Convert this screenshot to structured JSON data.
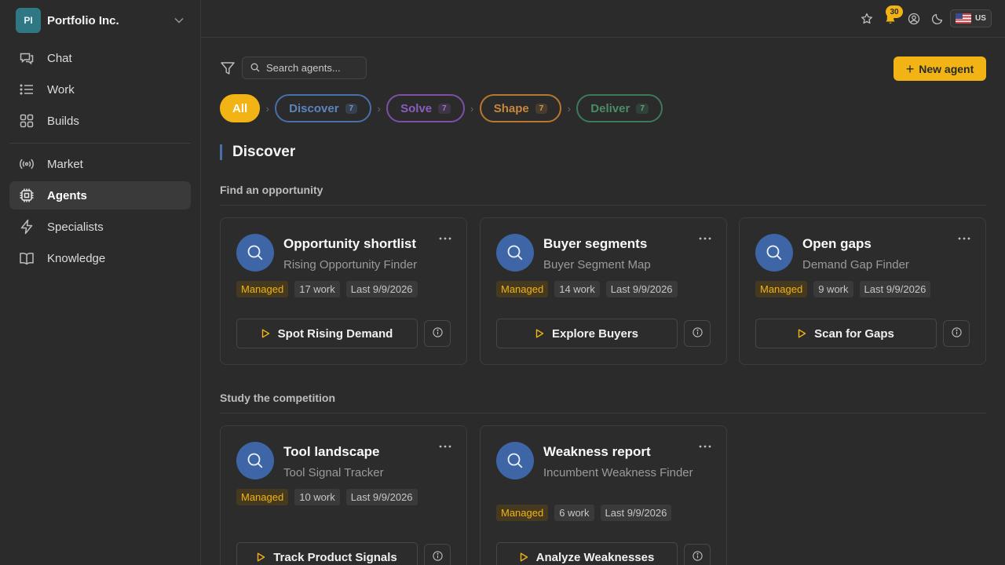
{
  "org": {
    "initials": "PI",
    "name": "Portfolio Inc."
  },
  "nav": {
    "primary": [
      {
        "label": "Chat",
        "icon": "chat-icon"
      },
      {
        "label": "Work",
        "icon": "list-icon"
      },
      {
        "label": "Builds",
        "icon": "grid-icon"
      }
    ],
    "secondary": [
      {
        "label": "Market",
        "icon": "broadcast-icon"
      },
      {
        "label": "Agents",
        "icon": "chip-icon",
        "active": true
      },
      {
        "label": "Specialists",
        "icon": "lightning-icon"
      },
      {
        "label": "Knowledge",
        "icon": "book-icon"
      }
    ]
  },
  "topbar": {
    "notifications_count": "30",
    "locale": "US"
  },
  "toolbar": {
    "search_placeholder": "Search agents...",
    "new_agent_label": "New agent",
    "new_agent_icon": "+"
  },
  "stages": [
    {
      "label": "All",
      "key": "all"
    },
    {
      "label": "Discover",
      "count": "7",
      "key": "discover"
    },
    {
      "label": "Solve",
      "count": "7",
      "key": "solve"
    },
    {
      "label": "Shape",
      "count": "7",
      "key": "shape"
    },
    {
      "label": "Deliver",
      "count": "7",
      "key": "deliver"
    }
  ],
  "stage_separator": "›",
  "section": {
    "title": "Discover",
    "accent": "#4a6fa8"
  },
  "groups": [
    {
      "title": "Find an opportunity",
      "cards": [
        {
          "title": "Opportunity shortlist",
          "subtitle": "Rising Opportunity Finder",
          "tag": "Managed",
          "work": "17 work",
          "last": "Last 9/9/2026",
          "action": "Spot Rising Demand"
        },
        {
          "title": "Buyer segments",
          "subtitle": "Buyer Segment Map",
          "tag": "Managed",
          "work": "14 work",
          "last": "Last 9/9/2026",
          "action": "Explore Buyers"
        },
        {
          "title": "Open gaps",
          "subtitle": "Demand Gap Finder",
          "tag": "Managed",
          "work": "9 work",
          "last": "Last 9/9/2026",
          "action": "Scan for Gaps"
        }
      ]
    },
    {
      "title": "Study the competition",
      "cards": [
        {
          "title": "Tool landscape",
          "subtitle": "Tool Signal Tracker",
          "tag": "Managed",
          "work": "10 work",
          "last": "Last 9/9/2026",
          "action": "Track Product Signals"
        },
        {
          "title": "Weakness report",
          "subtitle": "Incumbent Weakness Finder",
          "tag": "Managed",
          "work": "6 work",
          "last": "Last 9/9/2026",
          "action": "Analyze Weaknesses"
        }
      ]
    }
  ],
  "colors": {
    "accent": "#f2b315",
    "avatar": "#3e66a6",
    "background": "#2b2b2b"
  }
}
